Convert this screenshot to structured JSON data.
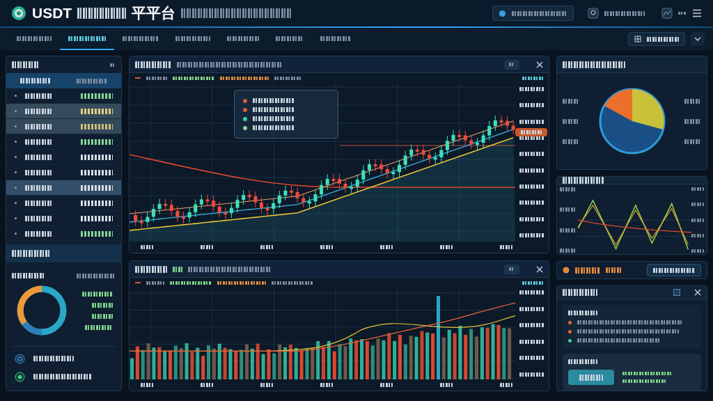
{
  "header": {
    "brand": "USDT",
    "title_tail": "平平台"
  },
  "nav": {
    "tabs": [
      {
        "selected": false
      },
      {
        "selected": true
      },
      {
        "selected": false
      },
      {
        "selected": false
      },
      {
        "selected": false
      },
      {
        "selected": false
      },
      {
        "selected": false
      }
    ]
  },
  "watchlist": {
    "rows": [
      {
        "highlighted": false,
        "color": "#86d39a"
      },
      {
        "highlighted": true,
        "color": "#e0cf84"
      },
      {
        "highlighted": true,
        "color": "#cdbb7c"
      },
      {
        "highlighted": false,
        "color": "#86d39a"
      },
      {
        "highlighted": false,
        "color": "#d5dde5"
      },
      {
        "highlighted": false,
        "color": "#d5dde5"
      },
      {
        "highlighted": true,
        "color": "#d5dde5"
      },
      {
        "highlighted": false,
        "color": "#d5dde5"
      },
      {
        "highlighted": false,
        "color": "#d5dde5"
      },
      {
        "highlighted": false,
        "color": "#86d39a"
      }
    ]
  },
  "main_chart": {
    "tooltip": [
      {
        "color": "#e0533d"
      },
      {
        "color": "#e0533d"
      },
      {
        "color": "#3fcf9f"
      },
      {
        "color": "#8fd08f"
      }
    ]
  },
  "info_panel": {
    "items": [
      {
        "color": "#e8643a"
      },
      {
        "color": "#e8643a"
      },
      {
        "color": "#3fd0a0"
      }
    ]
  }
}
